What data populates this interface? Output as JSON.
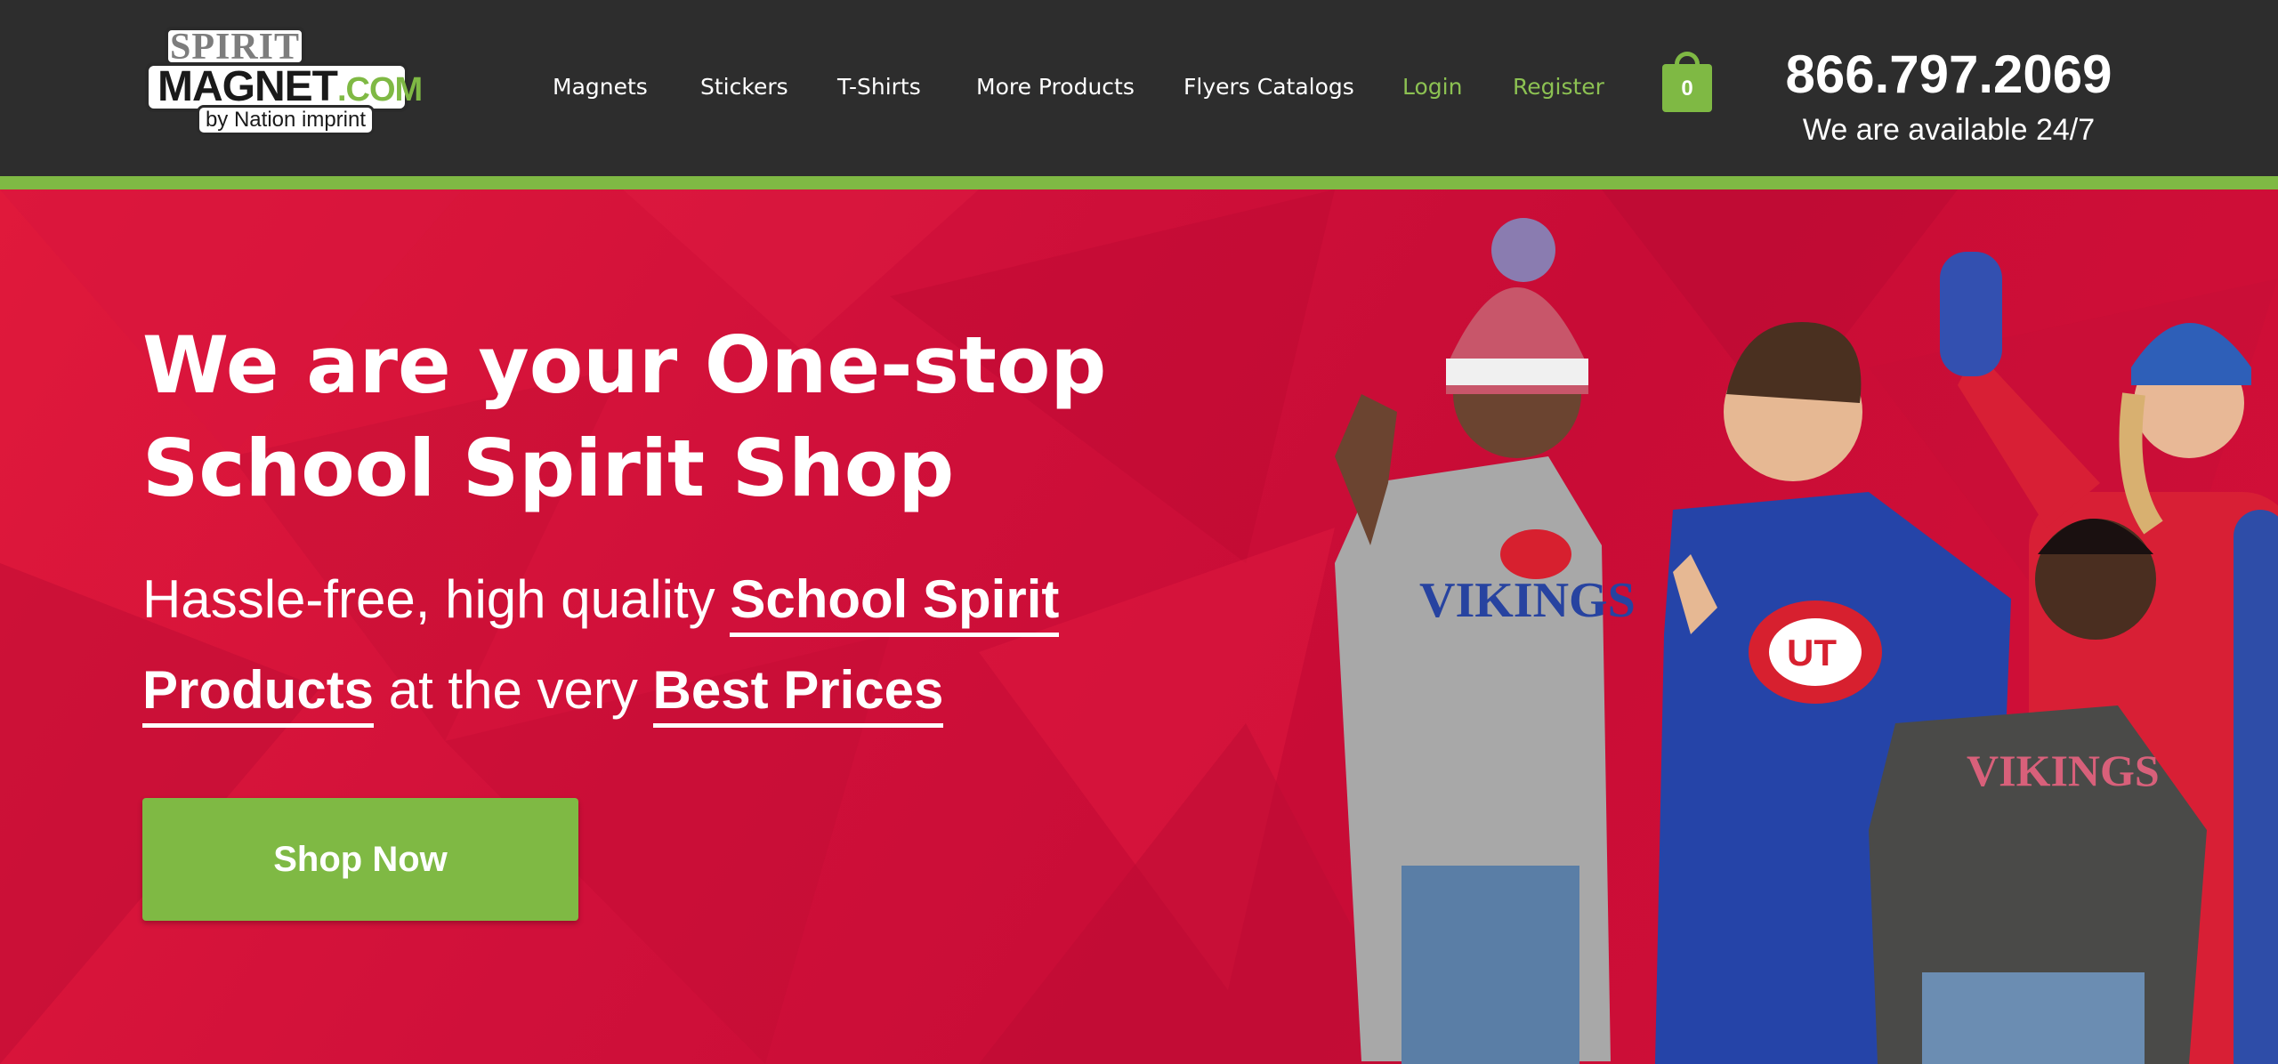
{
  "logo": {
    "line1": "SPIRIT",
    "line2": "MAGNET",
    "line2_suffix": ".COM",
    "line3": "by Nation imprint"
  },
  "nav": {
    "items": [
      {
        "label": "Magnets"
      },
      {
        "label": "Stickers"
      },
      {
        "label": "T-Shirts"
      },
      {
        "label": "More Products"
      },
      {
        "label": "Flyers Catalogs"
      },
      {
        "label": "Login"
      },
      {
        "label": "Register"
      }
    ]
  },
  "cart": {
    "count": "0",
    "icon": "shopping-bag-icon"
  },
  "contact": {
    "phone": "866.797.2069",
    "availability": "We are available 24/7"
  },
  "hero": {
    "title_line1": "We are your One-stop",
    "title_line2": "School Spirit Shop",
    "sub_part1": "Hassle-free, high quality ",
    "sub_bold1a": "School Spirit",
    "sub_bold1b": "Products",
    "sub_part2": " at the very ",
    "sub_bold2": "Best Prices",
    "cta": "Shop Now",
    "garment_text_1": "VIKINGS",
    "garment_text_2": "VIKINGS",
    "garment_logo": "UT"
  },
  "colors": {
    "header_bg": "#2d2d2d",
    "accent_green": "#7fb944",
    "hero_red": "#d0103a",
    "nav_text": "#ffffff",
    "nav_highlight": "#8cc152"
  }
}
